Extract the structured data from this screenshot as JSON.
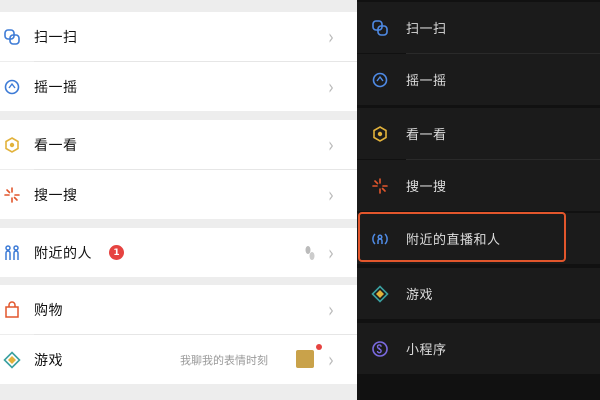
{
  "light_menu": {
    "items": [
      {
        "label": "扫一扫",
        "icon": "scan-icon"
      },
      {
        "label": "摇一摇",
        "icon": "shake-icon"
      },
      {
        "label": "看一看",
        "icon": "look-icon"
      },
      {
        "label": "搜一搜",
        "icon": "search-icon"
      },
      {
        "label": "附近的人",
        "icon": "nearby-people-icon",
        "badge": "1"
      },
      {
        "label": "购物",
        "icon": "shopping-bag-icon"
      },
      {
        "label": "游戏",
        "icon": "game-icon",
        "tail_text": "我聊我的表情时刻"
      }
    ]
  },
  "dark_menu": {
    "items": [
      {
        "label": "扫一扫",
        "icon": "scan-icon"
      },
      {
        "label": "摇一摇",
        "icon": "shake-icon"
      },
      {
        "label": "看一看",
        "icon": "look-icon"
      },
      {
        "label": "搜一搜",
        "icon": "search-icon"
      },
      {
        "label": "附近的直播和人",
        "icon": "nearby-live-icon",
        "highlighted": true
      },
      {
        "label": "游戏",
        "icon": "game-icon"
      },
      {
        "label": "小程序",
        "icon": "mini-program-icon"
      }
    ]
  },
  "colors": {
    "light_bg": "#ededed",
    "dark_bg": "#111111",
    "highlight": "#e2562c",
    "badge": "#e64340"
  }
}
